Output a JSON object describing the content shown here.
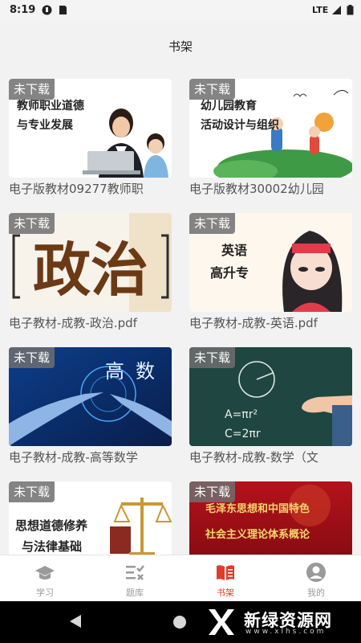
{
  "status_bar": {
    "time": "8:19",
    "network": "LTE",
    "icons": [
      "app-notification-icon",
      "sim-card-icon",
      "signal-icon",
      "battery-icon"
    ]
  },
  "header": {
    "title": "书架"
  },
  "books": [
    {
      "badge": "未下载",
      "title": "电子版教材09277教师职",
      "cover_text": [
        "教师职业道德",
        "与专业发展"
      ],
      "cover_icon": "teacher-child-photo"
    },
    {
      "badge": "未下载",
      "title": "电子版教材30002幼儿园",
      "cover_text": [
        "幼儿园教育",
        "活动设计与组织"
      ],
      "cover_icon": "kids-playing-illustration"
    },
    {
      "badge": "未下载",
      "title": "电子教材-成教-政治.pdf",
      "cover_text": [
        "政治"
      ],
      "cover_icon": "politics-calligraphy"
    },
    {
      "badge": "未下载",
      "title": "电子教材-成教-英语.pdf",
      "cover_text": [
        "英语",
        "高升专"
      ],
      "cover_icon": "student-girl-cartoon"
    },
    {
      "badge": "未下载",
      "title": "电子教材-成教-高等数学",
      "cover_text": [
        "高",
        "数"
      ],
      "cover_icon": "hands-touching-tech"
    },
    {
      "badge": "未下载",
      "title": "电子教材-成教-数学（文",
      "cover_text": [
        "A=πr²",
        "C=2πr"
      ],
      "cover_icon": "chalkboard-formula"
    },
    {
      "badge": "未下载",
      "title": "",
      "cover_text": [
        "思想道德修养",
        "与法律基础"
      ],
      "cover_icon": "scales-of-justice"
    },
    {
      "badge": "未下载",
      "title": "",
      "cover_text": [
        "毛泽东思想和中国特色",
        "社会主义理论体系概论"
      ],
      "cover_icon": "red-flag-banner"
    }
  ],
  "tabs": [
    {
      "label": "学习",
      "icon": "graduation-cap-icon",
      "active": false
    },
    {
      "label": "题库",
      "icon": "checklist-icon",
      "active": false
    },
    {
      "label": "书架",
      "icon": "book-icon",
      "active": true
    },
    {
      "label": "我的",
      "icon": "user-avatar-icon",
      "active": false
    }
  ],
  "watermark": {
    "name": "新绿资源网",
    "url": "www.xlhs.com"
  },
  "colors": {
    "accent": "#e03c2b",
    "tab_inactive": "#9a9a9a",
    "badge_bg": "#6e6e6e"
  }
}
